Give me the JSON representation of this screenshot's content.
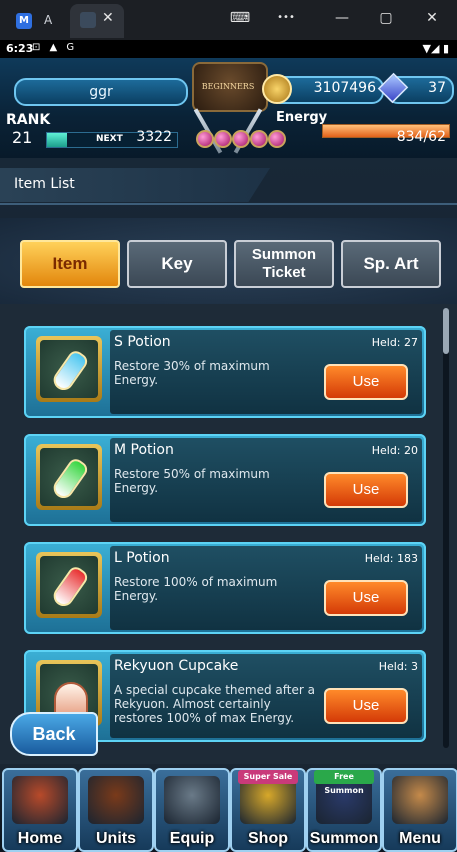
{
  "chrome": {
    "tab1_title": "A",
    "tab1_icon": "M",
    "close_tab": "✕",
    "controls": {
      "keyboard": "⌨",
      "more": "•••",
      "minimize": "—",
      "maximize": "▢",
      "close": "✕"
    }
  },
  "status_bar": {
    "time": "6:23",
    "left_icons": "⊡ ▲ G",
    "right_icons": "▼◢ ▮"
  },
  "hud": {
    "player_name": "ggr",
    "emblem_label": "BEGINNERS",
    "gold": "3107496",
    "lapis": "37",
    "rank_label": "RANK",
    "rank": "21",
    "next_label": "NEXT",
    "next_exp": "3322",
    "rank_progress": 0.15,
    "energy_label": "Energy",
    "energy": "834/62",
    "energy_fill": 1.0
  },
  "header": {
    "title": "Item List"
  },
  "categories": [
    {
      "label": "Item",
      "selected": true
    },
    {
      "label": "Key",
      "selected": false
    },
    {
      "label_line1": "Summon",
      "label_line2": "Ticket",
      "selected": false
    },
    {
      "label": "Sp. Art",
      "selected": false
    }
  ],
  "items": [
    {
      "name": "S Potion",
      "held": "Held: 27",
      "desc": "Restore 30% of maximum Energy.",
      "use": "Use",
      "potion_color": "#4ac6f0"
    },
    {
      "name": "M Potion",
      "held": "Held: 20",
      "desc": "Restore 50% of maximum Energy.",
      "use": "Use",
      "potion_color": "#37d640"
    },
    {
      "name": "L Potion",
      "held": "Held: 183",
      "desc": "Restore 100% of maximum Energy.",
      "use": "Use",
      "potion_color": "#e83030"
    },
    {
      "name": "Rekyuon Cupcake",
      "held": "Held: 3",
      "desc": "A special cupcake themed after a Rekyuon. Almost certainly restores 100% of max Energy.",
      "use": "Use",
      "potion_color": "#e9a58a"
    }
  ],
  "back_label": "Back",
  "nav": [
    {
      "label": "Home",
      "art_color": "#b84a2a"
    },
    {
      "label": "Units",
      "art_color": "#7a3a1a"
    },
    {
      "label": "Equip",
      "art_color": "#6a7a88"
    },
    {
      "label": "Shop",
      "badge": "Super Sale",
      "badge_color": "#c93a7a",
      "art_color": "#d7a82a"
    },
    {
      "label": "Summon",
      "badge": "Free Summon",
      "badge_color": "#2aa84a",
      "art_color": "#2a3a6a"
    },
    {
      "label": "Menu",
      "art_color": "#c58a4a"
    }
  ]
}
